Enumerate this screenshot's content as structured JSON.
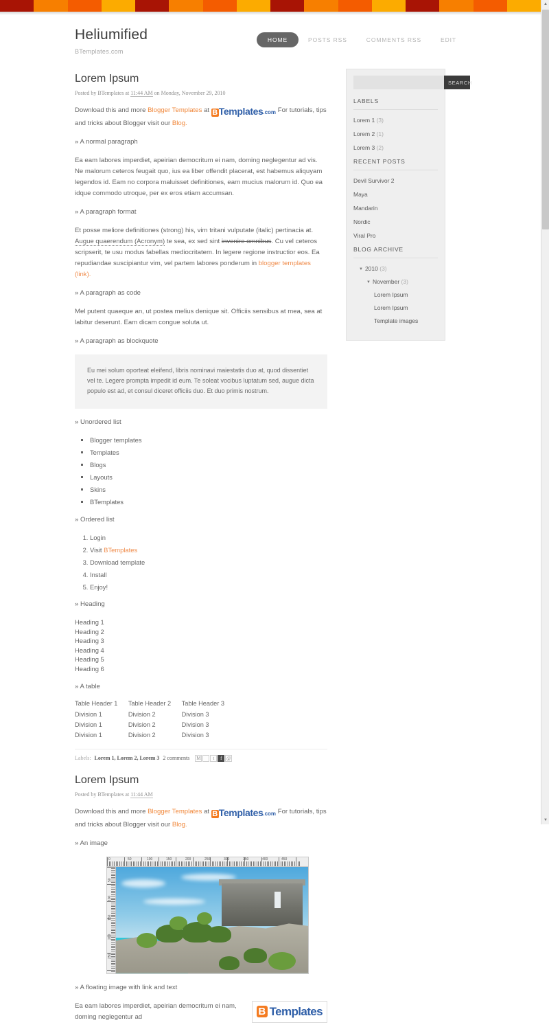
{
  "stripe": {
    "colors": [
      "#a81405",
      "#f77f00",
      "#f45c00",
      "#fcab00",
      "#a81405",
      "#f77f00",
      "#f45c00",
      "#fcab00",
      "#a81405",
      "#f77f00",
      "#f45c00",
      "#fcab00",
      "#a81405",
      "#f77f00",
      "#f45c00",
      "#fcab00"
    ]
  },
  "header": {
    "title": "Heliumified",
    "description": "BTemplates.com",
    "nav": [
      {
        "label": "HOME",
        "active": true
      },
      {
        "label": "POSTS RSS",
        "active": false
      },
      {
        "label": "COMMENTS RSS",
        "active": false
      },
      {
        "label": "EDIT",
        "active": false
      }
    ]
  },
  "post1": {
    "title": "Lorem Ipsum",
    "meta_prefix": "Posted by BTemplates at ",
    "meta_time": "11:44 AM",
    "meta_suffix": " on Monday, November 29, 2010",
    "intro_a": "Download this and more ",
    "intro_link": "Blogger Templates",
    "intro_b": " at ",
    "logo_mark": "B",
    "logo_text": "Templates",
    "logo_com": ".com",
    "intro_c": " For tutorials, tips and tricks about Blogger visit our ",
    "intro_link2": "Blog.",
    "sub_normal": "» A normal paragraph",
    "para_normal": "Ea eam labores imperdiet, apeirian democritum ei nam, doming neglegentur ad vis. Ne malorum ceteros feugait quo, ius ea liber offendit placerat, est habemus aliquyam legendos id. Eam no corpora maluisset definitiones, eam mucius malorum id. Quo ea idque commodo utroque, per ex eros etiam accumsan.",
    "sub_format": "» A paragraph format",
    "fmt_1": "Et posse meliore definitiones (strong) his, vim tritani vulputate (italic) pertinacia at. ",
    "fmt_acr": "Augue quaerendum (Acronym)",
    "fmt_2": " te sea, ex sed sint ",
    "fmt_strike": "invenire omnibus",
    "fmt_3": ". Cu vel ceteros scripserit, te usu modus fabellas mediocritatem. In legere regione instructior eos. Ea repudiandae suscipiantur vim, vel partem labores ponderum in ",
    "fmt_link": "blogger templates (link).",
    "sub_code": "» A paragraph as code",
    "para_code": "Mel putent quaeque an, ut postea melius denique sit. Officiis sensibus at mea, sea at labitur deserunt. Eam dicam congue soluta ut.",
    "sub_quote": "» A paragraph as blockquote",
    "blockquote": "Eu mei solum oporteat eleifend, libris nominavi maiestatis duo at, quod dissentiet vel te. Legere prompta impedit id eum. Te soleat vocibus luptatum sed, augue dicta populo est ad, et consul diceret officiis duo. Et duo primis nostrum.",
    "sub_ul": "» Unordered list",
    "ul_items": [
      "Blogger templates",
      "Templates",
      "Blogs",
      "Layouts",
      "Skins",
      "BTemplates"
    ],
    "sub_ol": "» Ordered list",
    "ol_items": [
      "Login",
      "Visit ",
      "Download template",
      "Install",
      "Enjoy!"
    ],
    "ol_link": "BTemplates",
    "sub_heading": "» Heading",
    "headings": [
      "Heading 1",
      "Heading 2",
      "Heading 3",
      "Heading 4",
      "Heading 5",
      "Heading 6"
    ],
    "sub_table": "» A table",
    "table": {
      "headers": [
        "Table Header 1",
        "Table Header 2",
        "Table Header 3"
      ],
      "rows": [
        [
          "Division 1",
          "Division 2",
          "Division 3"
        ],
        [
          "Division 1",
          "Division 2",
          "Division 3"
        ],
        [
          "Division 1",
          "Division 2",
          "Division 3"
        ]
      ]
    },
    "footer": {
      "labels_caption": "Labels:",
      "labels": "Lorem 1, Lorem 2, Lorem 3",
      "comments": "2 comments",
      "share_icons": [
        "email-icon",
        "blogthis-icon",
        "twitter-icon",
        "facebook-icon",
        "pinterest-icon"
      ]
    }
  },
  "post2": {
    "title": "Lorem Ipsum",
    "meta_prefix": "Posted by BTemplates at ",
    "meta_time": "11:44 AM",
    "intro_a": "Download this and more ",
    "intro_link": "Blogger Templates",
    "intro_b": " at ",
    "logo_mark": "B",
    "logo_text": "Templates",
    "logo_com": ".com",
    "intro_c": " For tutorials, tips and tricks about Blogger visit our ",
    "intro_link2": "Blog.",
    "sub_image": "» An image",
    "image_alt": "mayan-ruins-photo",
    "ruler_top_labels": [
      "0",
      "50",
      "100",
      "150",
      "200",
      "250",
      "300",
      "350",
      "400",
      "450"
    ],
    "ruler_left_labels": [
      "50",
      "100",
      "150",
      "200",
      "250"
    ],
    "sub_float": "» A floating image with link and text",
    "float_text": "Ea eam labores imperdiet, apeirian democritum ei nam, doming neglegentur ad",
    "float_logo_mark": "B",
    "float_logo_text": "Templates"
  },
  "sidebar": {
    "search": {
      "placeholder": "",
      "value": "",
      "button": "SEARCH",
      "icon": "search-icon"
    },
    "labels": {
      "title": "LABELS",
      "items": [
        {
          "name": "Lorem 1",
          "count": "(3)"
        },
        {
          "name": "Lorem 2",
          "count": "(1)"
        },
        {
          "name": "Lorem 3",
          "count": "(2)"
        }
      ]
    },
    "recent": {
      "title": "RECENT POSTS",
      "items": [
        "Devil Survivor 2",
        "Maya",
        "Mandarin",
        "Nordic",
        "Viral Pro"
      ]
    },
    "archive": {
      "title": "BLOG ARCHIVE",
      "year": "2010",
      "year_count": "(3)",
      "month": "November",
      "month_count": "(3)",
      "posts": [
        "Lorem Ipsum",
        "Lorem Ipsum",
        "Template images"
      ]
    }
  },
  "colors": {
    "accent_orange": "#f47b20",
    "link_orange": "#f0873a",
    "logo_blue": "#2f5fa8",
    "nav_active_bg": "#666666",
    "sidebar_bg": "#efefef"
  }
}
